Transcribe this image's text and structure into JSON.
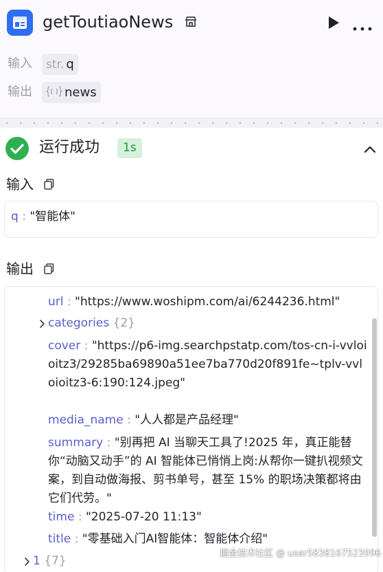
{
  "node": {
    "title": "getToutiaoNews",
    "input_label": "输入",
    "input_type": "str.",
    "input_name": "q",
    "output_label": "输出",
    "output_name": "news",
    "accent": "#2f6ef3"
  },
  "run": {
    "status": "运行成功",
    "duration": "1s",
    "success_color": "#2fb050"
  },
  "input_section": {
    "title": "输入",
    "key": "q",
    "sep": ":",
    "value": "\"智能体\""
  },
  "output_section": {
    "title": "输出",
    "lines": [
      {
        "key": "url",
        "sep": ":",
        "value": "\"https://www.woshipm.com/ai/6244236.html\""
      },
      {
        "key": "categories",
        "count": "{2}"
      },
      {
        "key": "cover",
        "sep": ":",
        "value": "\"https://p6-img.searchpstatp.com/tos-cn-i-vvloioitz3/29285ba69890a51ee7ba770d20f891fe~tplv-vvloioitz3-6:190:124.jpeg\""
      },
      {
        "key": "media_name",
        "sep": ":",
        "value": "\"人人都是产品经理\""
      },
      {
        "key": "summary",
        "sep": ":",
        "value": "\"别再把 AI 当聊天工具了!2025 年，真正能替你“动脑又动手”的 AI 智能体已悄悄上岗:从帮你一键扒视频文案，到自动做海报、剪书单号，甚至 15% 的职场决策都将由它们代劳。\""
      },
      {
        "key": "time",
        "sep": ":",
        "value": "\"2025-07-20 11:13\""
      },
      {
        "key": "title",
        "sep": ":",
        "value": "\"零基础入门AI智能体：智能体介绍\""
      },
      {
        "key": "1",
        "count": "{7}"
      }
    ]
  },
  "watermark": "掘金技术社区 @ user5838167523996"
}
